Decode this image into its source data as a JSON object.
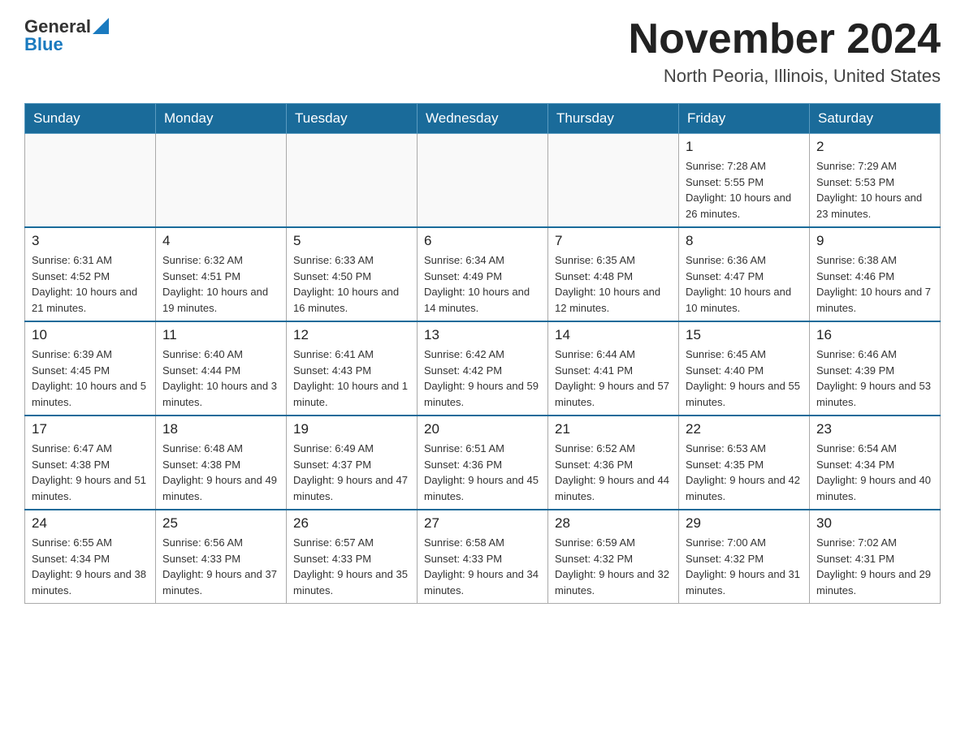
{
  "header": {
    "logo_general": "General",
    "logo_blue": "Blue",
    "month_title": "November 2024",
    "location": "North Peoria, Illinois, United States"
  },
  "days_of_week": [
    "Sunday",
    "Monday",
    "Tuesday",
    "Wednesday",
    "Thursday",
    "Friday",
    "Saturday"
  ],
  "weeks": [
    [
      {
        "day": "",
        "sunrise": "",
        "sunset": "",
        "daylight": ""
      },
      {
        "day": "",
        "sunrise": "",
        "sunset": "",
        "daylight": ""
      },
      {
        "day": "",
        "sunrise": "",
        "sunset": "",
        "daylight": ""
      },
      {
        "day": "",
        "sunrise": "",
        "sunset": "",
        "daylight": ""
      },
      {
        "day": "",
        "sunrise": "",
        "sunset": "",
        "daylight": ""
      },
      {
        "day": "1",
        "sunrise": "Sunrise: 7:28 AM",
        "sunset": "Sunset: 5:55 PM",
        "daylight": "Daylight: 10 hours and 26 minutes."
      },
      {
        "day": "2",
        "sunrise": "Sunrise: 7:29 AM",
        "sunset": "Sunset: 5:53 PM",
        "daylight": "Daylight: 10 hours and 23 minutes."
      }
    ],
    [
      {
        "day": "3",
        "sunrise": "Sunrise: 6:31 AM",
        "sunset": "Sunset: 4:52 PM",
        "daylight": "Daylight: 10 hours and 21 minutes."
      },
      {
        "day": "4",
        "sunrise": "Sunrise: 6:32 AM",
        "sunset": "Sunset: 4:51 PM",
        "daylight": "Daylight: 10 hours and 19 minutes."
      },
      {
        "day": "5",
        "sunrise": "Sunrise: 6:33 AM",
        "sunset": "Sunset: 4:50 PM",
        "daylight": "Daylight: 10 hours and 16 minutes."
      },
      {
        "day": "6",
        "sunrise": "Sunrise: 6:34 AM",
        "sunset": "Sunset: 4:49 PM",
        "daylight": "Daylight: 10 hours and 14 minutes."
      },
      {
        "day": "7",
        "sunrise": "Sunrise: 6:35 AM",
        "sunset": "Sunset: 4:48 PM",
        "daylight": "Daylight: 10 hours and 12 minutes."
      },
      {
        "day": "8",
        "sunrise": "Sunrise: 6:36 AM",
        "sunset": "Sunset: 4:47 PM",
        "daylight": "Daylight: 10 hours and 10 minutes."
      },
      {
        "day": "9",
        "sunrise": "Sunrise: 6:38 AM",
        "sunset": "Sunset: 4:46 PM",
        "daylight": "Daylight: 10 hours and 7 minutes."
      }
    ],
    [
      {
        "day": "10",
        "sunrise": "Sunrise: 6:39 AM",
        "sunset": "Sunset: 4:45 PM",
        "daylight": "Daylight: 10 hours and 5 minutes."
      },
      {
        "day": "11",
        "sunrise": "Sunrise: 6:40 AM",
        "sunset": "Sunset: 4:44 PM",
        "daylight": "Daylight: 10 hours and 3 minutes."
      },
      {
        "day": "12",
        "sunrise": "Sunrise: 6:41 AM",
        "sunset": "Sunset: 4:43 PM",
        "daylight": "Daylight: 10 hours and 1 minute."
      },
      {
        "day": "13",
        "sunrise": "Sunrise: 6:42 AM",
        "sunset": "Sunset: 4:42 PM",
        "daylight": "Daylight: 9 hours and 59 minutes."
      },
      {
        "day": "14",
        "sunrise": "Sunrise: 6:44 AM",
        "sunset": "Sunset: 4:41 PM",
        "daylight": "Daylight: 9 hours and 57 minutes."
      },
      {
        "day": "15",
        "sunrise": "Sunrise: 6:45 AM",
        "sunset": "Sunset: 4:40 PM",
        "daylight": "Daylight: 9 hours and 55 minutes."
      },
      {
        "day": "16",
        "sunrise": "Sunrise: 6:46 AM",
        "sunset": "Sunset: 4:39 PM",
        "daylight": "Daylight: 9 hours and 53 minutes."
      }
    ],
    [
      {
        "day": "17",
        "sunrise": "Sunrise: 6:47 AM",
        "sunset": "Sunset: 4:38 PM",
        "daylight": "Daylight: 9 hours and 51 minutes."
      },
      {
        "day": "18",
        "sunrise": "Sunrise: 6:48 AM",
        "sunset": "Sunset: 4:38 PM",
        "daylight": "Daylight: 9 hours and 49 minutes."
      },
      {
        "day": "19",
        "sunrise": "Sunrise: 6:49 AM",
        "sunset": "Sunset: 4:37 PM",
        "daylight": "Daylight: 9 hours and 47 minutes."
      },
      {
        "day": "20",
        "sunrise": "Sunrise: 6:51 AM",
        "sunset": "Sunset: 4:36 PM",
        "daylight": "Daylight: 9 hours and 45 minutes."
      },
      {
        "day": "21",
        "sunrise": "Sunrise: 6:52 AM",
        "sunset": "Sunset: 4:36 PM",
        "daylight": "Daylight: 9 hours and 44 minutes."
      },
      {
        "day": "22",
        "sunrise": "Sunrise: 6:53 AM",
        "sunset": "Sunset: 4:35 PM",
        "daylight": "Daylight: 9 hours and 42 minutes."
      },
      {
        "day": "23",
        "sunrise": "Sunrise: 6:54 AM",
        "sunset": "Sunset: 4:34 PM",
        "daylight": "Daylight: 9 hours and 40 minutes."
      }
    ],
    [
      {
        "day": "24",
        "sunrise": "Sunrise: 6:55 AM",
        "sunset": "Sunset: 4:34 PM",
        "daylight": "Daylight: 9 hours and 38 minutes."
      },
      {
        "day": "25",
        "sunrise": "Sunrise: 6:56 AM",
        "sunset": "Sunset: 4:33 PM",
        "daylight": "Daylight: 9 hours and 37 minutes."
      },
      {
        "day": "26",
        "sunrise": "Sunrise: 6:57 AM",
        "sunset": "Sunset: 4:33 PM",
        "daylight": "Daylight: 9 hours and 35 minutes."
      },
      {
        "day": "27",
        "sunrise": "Sunrise: 6:58 AM",
        "sunset": "Sunset: 4:33 PM",
        "daylight": "Daylight: 9 hours and 34 minutes."
      },
      {
        "day": "28",
        "sunrise": "Sunrise: 6:59 AM",
        "sunset": "Sunset: 4:32 PM",
        "daylight": "Daylight: 9 hours and 32 minutes."
      },
      {
        "day": "29",
        "sunrise": "Sunrise: 7:00 AM",
        "sunset": "Sunset: 4:32 PM",
        "daylight": "Daylight: 9 hours and 31 minutes."
      },
      {
        "day": "30",
        "sunrise": "Sunrise: 7:02 AM",
        "sunset": "Sunset: 4:31 PM",
        "daylight": "Daylight: 9 hours and 29 minutes."
      }
    ]
  ]
}
